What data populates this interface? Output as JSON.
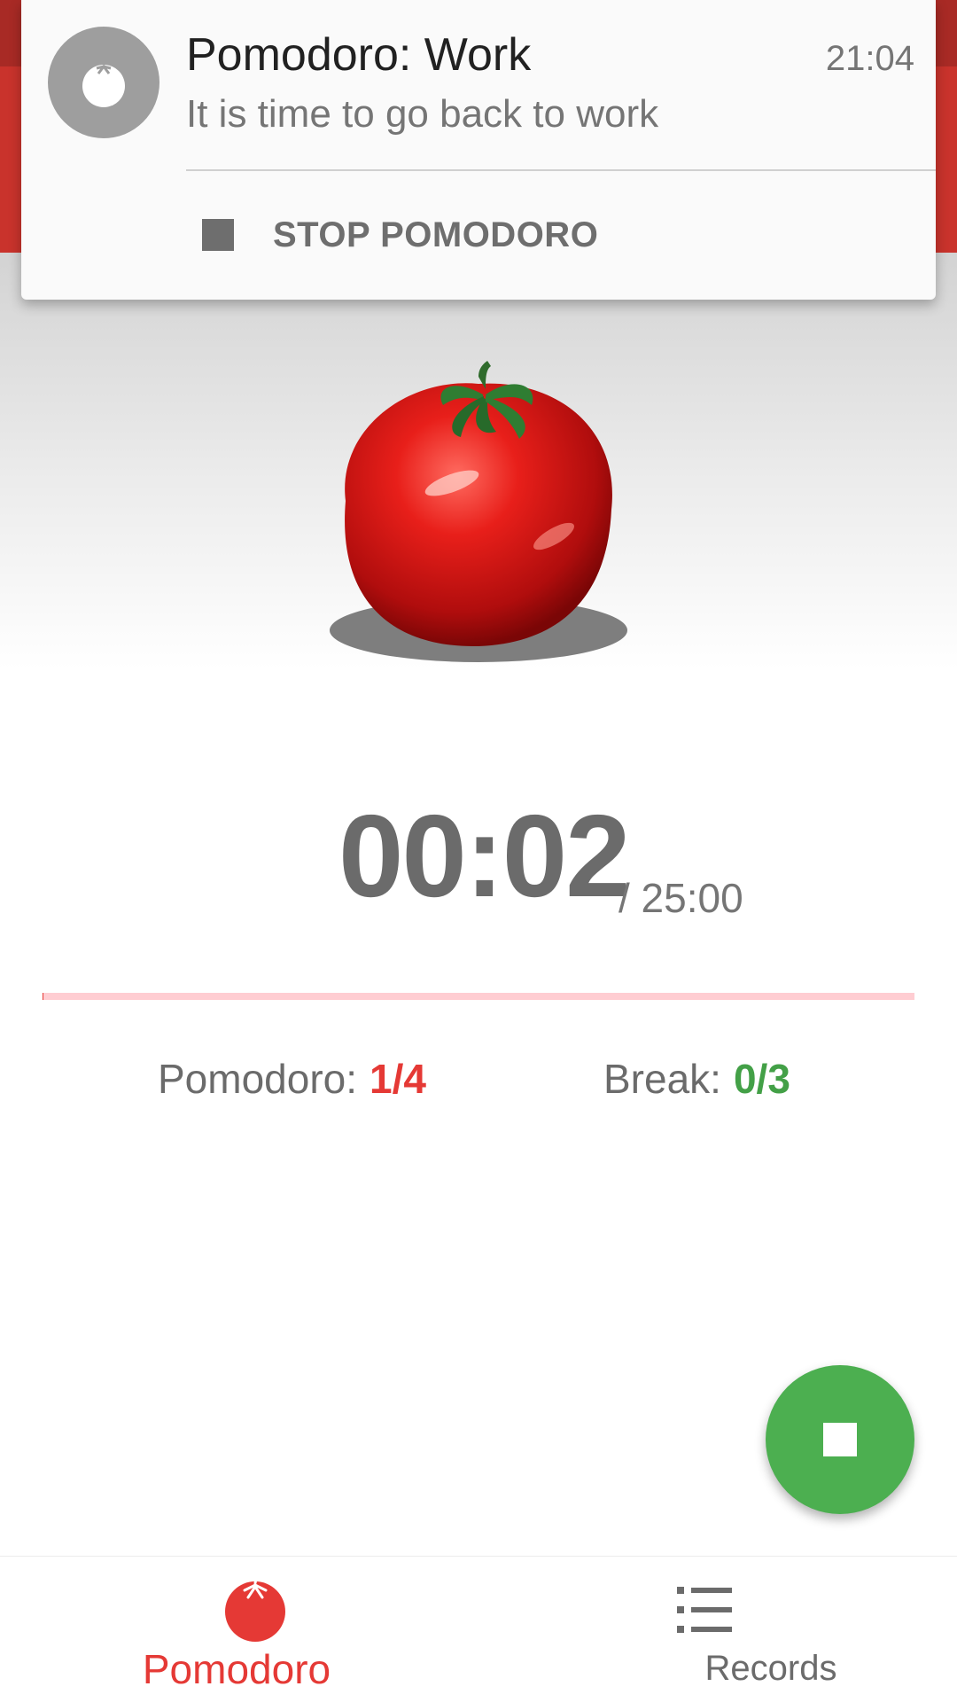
{
  "notification": {
    "title": "Pomodoro: Work",
    "time": "21:04",
    "body": "It is time to go back to work",
    "action_label": "STOP POMODORO",
    "icon": "tomato-icon"
  },
  "timer": {
    "elapsed": "00:02",
    "total": "/ 25:00",
    "progress": 0.0013
  },
  "counters": {
    "pomodoro_label": "Pomodoro:",
    "pomodoro_value": "1/4",
    "break_label": "Break:",
    "break_value": "0/3"
  },
  "fab": {
    "icon": "stop-icon"
  },
  "bottom_nav": {
    "items": [
      {
        "label": "Pomodoro",
        "icon": "tomato-icon",
        "selected": true
      },
      {
        "label": "Records",
        "icon": "list-icon",
        "selected": false
      }
    ]
  },
  "colors": {
    "primary": "#c9332c",
    "accent_red": "#e53935",
    "accent_green": "#4caf50",
    "progress_track": "#ffcdd2"
  }
}
